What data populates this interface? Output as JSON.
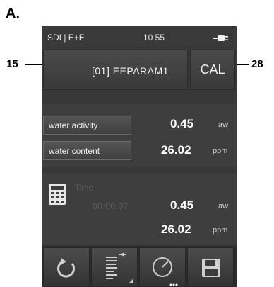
{
  "figure_label": "A.",
  "callouts": {
    "left": "15",
    "right": "28"
  },
  "status_bar": {
    "left_text": "SDI | E+E",
    "time": "10 55",
    "power_icon": "plug-icon"
  },
  "header": {
    "eeparam_label": "[01] EEPARAM1",
    "cal_label": "CAL"
  },
  "measurements": [
    {
      "label": "water activity",
      "value": "0.45",
      "unit": "aw"
    },
    {
      "label": "water content",
      "value": "26.02",
      "unit": "ppm"
    }
  ],
  "calculation": {
    "icon": "calculator-icon",
    "time_label": "Time",
    "time_value": "00:00:07",
    "values": [
      {
        "value": "0.45",
        "unit": "aw"
      },
      {
        "value": "26.02",
        "unit": "ppm"
      }
    ]
  },
  "toolbar": [
    "refresh-icon",
    "list-options-icon",
    "gauge-icon",
    "save-icon"
  ],
  "colors": {
    "screen_bg": "#383838",
    "button_bg": "#4a4a4a",
    "text": "#ffffff"
  }
}
